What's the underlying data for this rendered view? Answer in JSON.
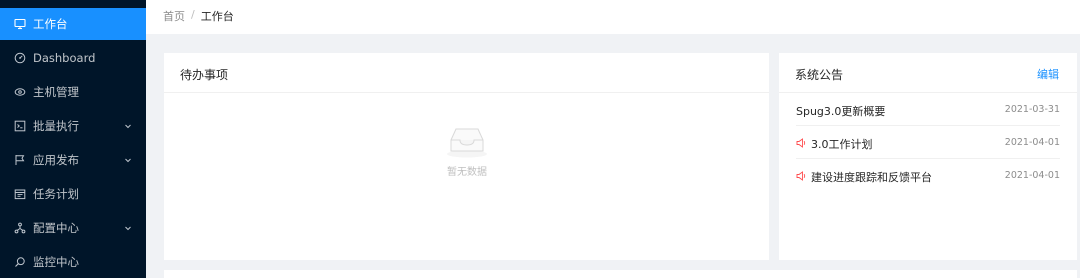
{
  "sidebar": {
    "items": [
      {
        "label": "工作台",
        "icon": "desktop-icon",
        "active": true,
        "has_children": false
      },
      {
        "label": "Dashboard",
        "icon": "dashboard-icon",
        "active": false,
        "has_children": false
      },
      {
        "label": "主机管理",
        "icon": "cloud-server-icon",
        "active": false,
        "has_children": false
      },
      {
        "label": "批量执行",
        "icon": "code-icon",
        "active": false,
        "has_children": true
      },
      {
        "label": "应用发布",
        "icon": "flag-icon",
        "active": false,
        "has_children": true
      },
      {
        "label": "任务计划",
        "icon": "schedule-icon",
        "active": false,
        "has_children": false
      },
      {
        "label": "配置中心",
        "icon": "deployment-icon",
        "active": false,
        "has_children": true
      },
      {
        "label": "监控中心",
        "icon": "monitor-icon",
        "active": false,
        "has_children": false
      }
    ]
  },
  "header": {
    "breadcrumb": {
      "home": "首页",
      "separator": "/",
      "current": "工作台"
    }
  },
  "todo": {
    "title": "待办事项",
    "empty_text": "暂无数据"
  },
  "notice": {
    "title": "系统公告",
    "edit_label": "编辑",
    "items": [
      {
        "title": "Spug3.0更新概要",
        "date": "2021-03-31",
        "icon": null
      },
      {
        "title": "3.0工作计划",
        "date": "2021-04-01",
        "icon": "sound-icon"
      },
      {
        "title": "建设进度跟踪和反馈平台",
        "date": "2021-04-01",
        "icon": "sound-icon"
      }
    ]
  },
  "colors": {
    "sidebar_bg": "#001529",
    "accent": "#1890ff",
    "notice_icon": "#ff4d4f",
    "page_bg": "#f0f2f5"
  }
}
